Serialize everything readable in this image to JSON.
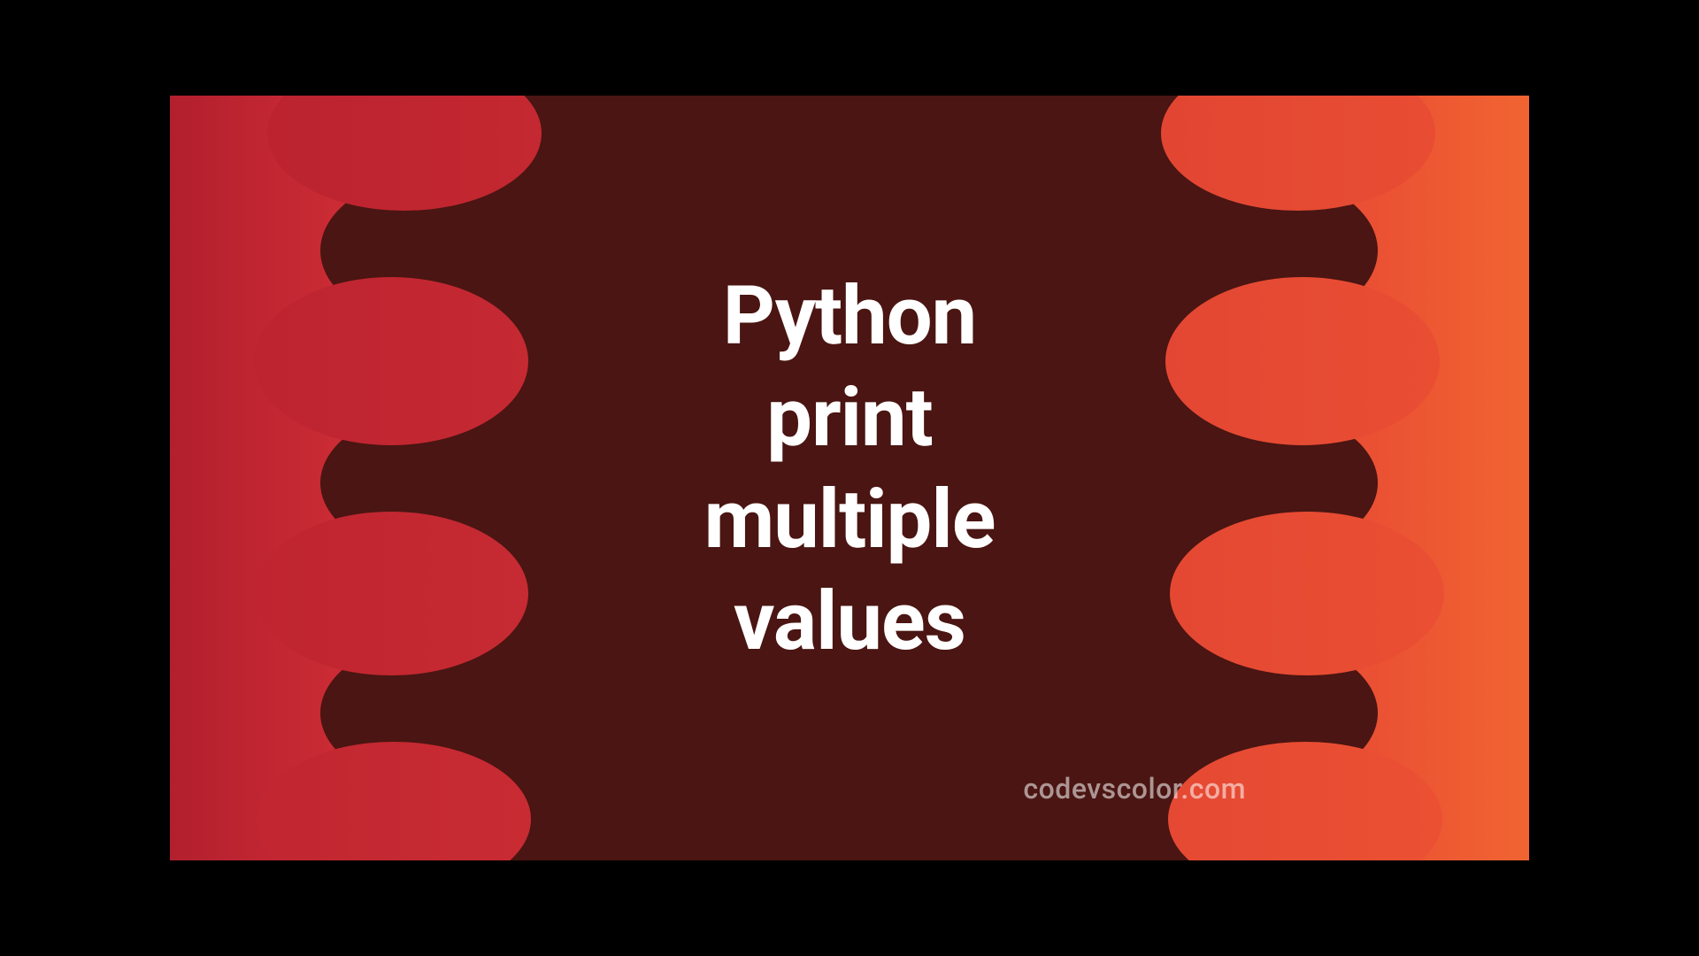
{
  "title_lines": [
    "Python",
    "print",
    "multiple",
    "values"
  ],
  "watermark": "codevscolor.com",
  "colors": {
    "gradient_left": "#b21f2e",
    "gradient_right": "#f16431",
    "blob": "#4a1512",
    "text": "#ffffff"
  }
}
